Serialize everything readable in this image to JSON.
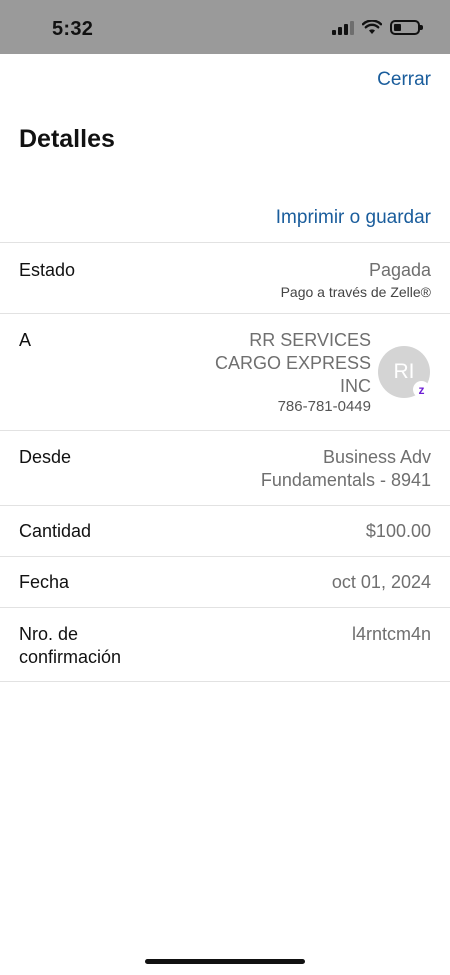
{
  "status_bar": {
    "time": "5:32"
  },
  "header": {
    "close_label": "Cerrar",
    "title": "Detalles",
    "print_label": "Imprimir o guardar"
  },
  "details": {
    "status": {
      "label": "Estado",
      "value": "Pagada",
      "note": "Pago a través de Zelle®"
    },
    "recipient": {
      "label": "A",
      "name_lines": [
        "RR SERVICES",
        "CARGO EXPRESS",
        "INC"
      ],
      "phone": "786-781-0449",
      "avatar_initials": "RI",
      "badge_icon": "zelle-icon"
    },
    "from": {
      "label": "Desde",
      "value_lines": [
        "Business Adv",
        "Fundamentals - 8941"
      ]
    },
    "amount": {
      "label": "Cantidad",
      "value": "$100.00"
    },
    "date": {
      "label": "Fecha",
      "value": "oct 01, 2024"
    },
    "confirmation": {
      "label_lines": [
        "Nro. de",
        "confirmación"
      ],
      "value": "l4rntcm4n"
    }
  },
  "colors": {
    "link": "#1a5d9c",
    "status_bar": "#9a9a9a",
    "zelle_purple": "#6d1ed4"
  }
}
